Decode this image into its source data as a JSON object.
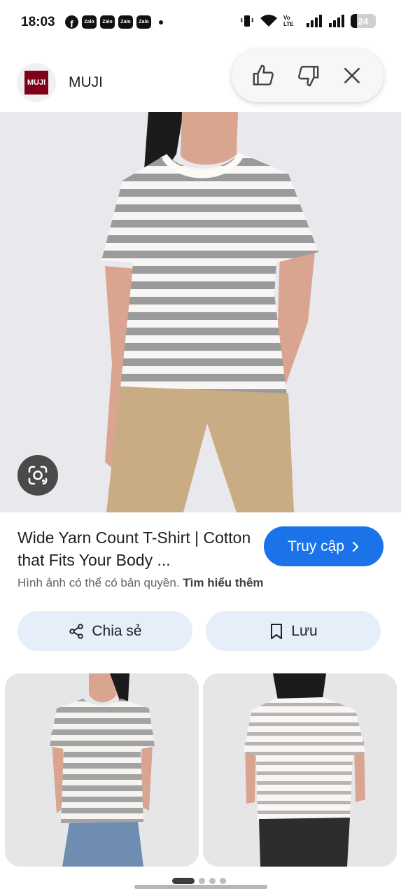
{
  "status_bar": {
    "time": "18:03",
    "notifications": [
      "facebook-icon",
      "zalo-icon",
      "zalo-icon",
      "zalo-icon",
      "zalo-icon"
    ],
    "zalo_label": "Zalo",
    "network_label": "Vo LTE",
    "battery_level": "24"
  },
  "source": {
    "logo_text": "MUJI",
    "name": "MUJI",
    "brand_color": "#7f0019"
  },
  "feedback": {
    "like_icon": "thumbs-up-icon",
    "dislike_icon": "thumbs-down-icon",
    "close_icon": "close-icon"
  },
  "result": {
    "title": "Wide Yarn Count T-Shirt | Cotton that Fits Your Body ...",
    "visit_label": "Truy cập",
    "copyright_text": "Hình ảnh có thể có bản quyền.",
    "learn_more": "Tìm hiểu thêm"
  },
  "actions": {
    "share_label": "Chia sẻ",
    "save_label": "Lưu"
  },
  "colors": {
    "accent": "#1a73e8",
    "action_bg": "#e6eef9"
  }
}
